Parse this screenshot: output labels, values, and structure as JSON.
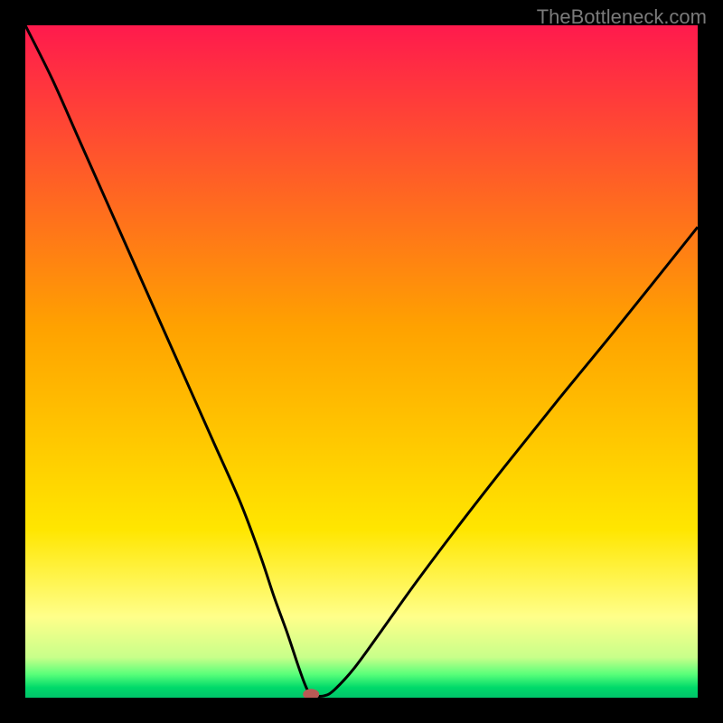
{
  "watermark": "TheBottleneck.com",
  "chart_data": {
    "type": "line",
    "title": "",
    "xlabel": "",
    "ylabel": "",
    "xlim": [
      0,
      100
    ],
    "ylim": [
      0,
      100
    ],
    "background_gradient": [
      {
        "stop": 0.0,
        "color": "#ff1a4d"
      },
      {
        "stop": 0.45,
        "color": "#ffa200"
      },
      {
        "stop": 0.75,
        "color": "#ffe600"
      },
      {
        "stop": 0.88,
        "color": "#ffff8a"
      },
      {
        "stop": 0.94,
        "color": "#c8ff8a"
      },
      {
        "stop": 0.965,
        "color": "#5aff7a"
      },
      {
        "stop": 0.985,
        "color": "#00d96a"
      },
      {
        "stop": 1.0,
        "color": "#00c46a"
      }
    ],
    "series": [
      {
        "name": "bottleneck-curve",
        "color": "#000000",
        "x": [
          0,
          4,
          8,
          12,
          16,
          20,
          24,
          28,
          32,
          35,
          37,
          39,
          40.5,
          41.5,
          42.2,
          42.8,
          44.5,
          46,
          49,
          53,
          58,
          64,
          71,
          79,
          88,
          100
        ],
        "y": [
          100,
          92,
          83,
          74,
          65,
          56,
          47,
          38,
          29,
          21,
          15,
          9.5,
          5,
          2.2,
          0.7,
          0.3,
          0.3,
          1.2,
          4.5,
          10,
          17,
          25,
          34,
          44,
          55,
          70
        ]
      }
    ],
    "marker": {
      "x": 42.5,
      "y": 0.5,
      "color": "#b85a55",
      "rx": 9,
      "ry": 6
    }
  }
}
